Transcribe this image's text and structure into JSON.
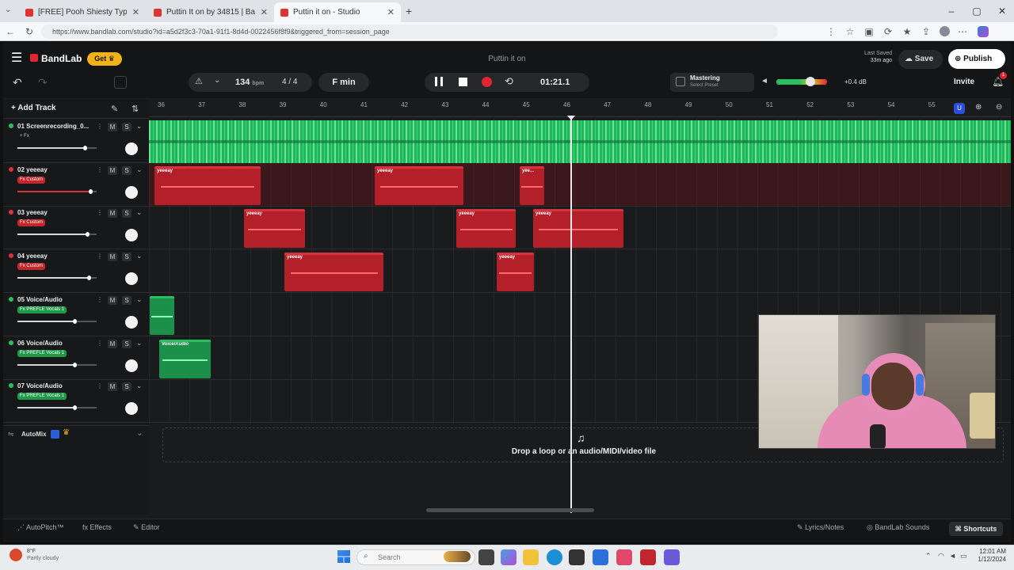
{
  "browser": {
    "tabs": [
      {
        "title": "[FREE] Pooh Shiesty Type Beat"
      },
      {
        "title": "Puttin It on by 34815 | BandLab"
      },
      {
        "title": "Puttin it on - Studio"
      }
    ],
    "url": "https://www.bandlab.com/studio?id=a5d2f3c3-70a1-91f1-8d4d-0022456f8f9&triggered_from=session_page"
  },
  "app": {
    "brand": "BandLab",
    "get_badge": "Get",
    "project_title": "Puttin it on",
    "last_saved_label": "Last Saved",
    "last_saved_value": "33m ago",
    "save_label": "Save",
    "publish_label": "Publish",
    "invite_label": "Invite",
    "notification_count": "1",
    "bpm": "134",
    "bpm_unit": "bpm",
    "time_signature": "4 / 4",
    "key": "F min",
    "time_display": "01:21.1",
    "mastering_title": "Mastering",
    "mastering_sub": "Select Preset",
    "master_gain": "+0.4 dB",
    "add_track": "Add Track",
    "drop_hint": "Drop a loop or an audio/MIDI/video file",
    "automix_label": "AutoMix"
  },
  "ruler": [
    "36",
    "37",
    "38",
    "39",
    "40",
    "41",
    "42",
    "43",
    "44",
    "45",
    "46",
    "47",
    "48",
    "49",
    "50",
    "51",
    "52",
    "53",
    "54",
    "55"
  ],
  "tracks": [
    {
      "name": "01 Screenrecording_0...",
      "badge": "+ Fx",
      "badge_color": "none",
      "color": "#2bbd62",
      "slider_pct": 0.85,
      "fill_color": "#d7d7d7"
    },
    {
      "name": "02 yeeeay",
      "badge": "Fx Custom",
      "badge_color": "red",
      "color": "#d8323c",
      "slider_pct": 0.92,
      "fill_color": "#d8323c"
    },
    {
      "name": "03 yeeeay",
      "badge": "Fx Custom",
      "badge_color": "red",
      "color": "#d8323c",
      "slider_pct": 0.88,
      "fill_color": "#d7d7d7"
    },
    {
      "name": "04 yeeeay",
      "badge": "Fx Custom",
      "badge_color": "red",
      "color": "#d8323c",
      "slider_pct": 0.9,
      "fill_color": "#d7d7d7"
    },
    {
      "name": "05 Voice/Audio",
      "badge": "Fx PREFLE Vocals 1",
      "badge_color": "green",
      "color": "#2bbd62",
      "slider_pct": 0.72,
      "fill_color": "#d7d7d7"
    },
    {
      "name": "06 Voice/Audio",
      "badge": "Fx PREFLE Vocals 1",
      "badge_color": "green",
      "color": "#2bbd62",
      "slider_pct": 0.72,
      "fill_color": "#d7d7d7"
    },
    {
      "name": "07 Voice/Audio",
      "badge": "Fx PREFLE Vocals 1",
      "badge_color": "green",
      "color": "#2bbd62",
      "slider_pct": 0.72,
      "fill_color": "#d7d7d7"
    }
  ],
  "clip_label": "yeeeay",
  "clip_label_short": "yee...",
  "clip_label_voice": "Voice/Audio",
  "bottom": {
    "autopitch": "AutoPitch™",
    "effects": "Effects",
    "editor": "Editor",
    "lyrics": "Lyrics/Notes",
    "sounds": "BandLab Sounds",
    "shortcuts": "Shortcuts"
  },
  "taskbar": {
    "search": "Search",
    "weather_temp": "8°F",
    "weather_desc": "Partly cloudy",
    "time": "12:01 AM",
    "date": "1/12/2024"
  }
}
